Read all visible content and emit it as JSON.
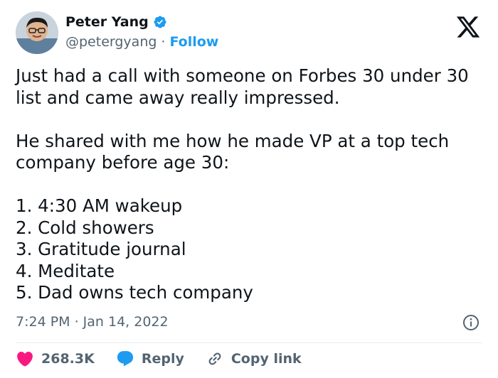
{
  "author": {
    "name": "Peter Yang",
    "handle": "@petergyang",
    "separator": "·",
    "follow_label": "Follow"
  },
  "tweet": {
    "paragraph1": "Just had a call with someone on Forbes 30 under 30 list and came away really impressed.",
    "paragraph2": "He shared with me how he made VP at a top tech company before age 30:",
    "list": [
      "1. 4:30 AM wakeup",
      "2. Cold showers",
      "3. Gratitude journal",
      "4. Meditate",
      "5. Dad owns tech company"
    ],
    "timestamp": "7:24 PM · Jan 14, 2022"
  },
  "actions": {
    "likes": "268.3K",
    "reply_label": "Reply",
    "copy_link_label": "Copy link"
  },
  "colors": {
    "accent": "#1d9bf0",
    "like": "#f91880",
    "text": "#0f1419",
    "muted": "#536471"
  },
  "icons": {
    "verified": "verified-badge-icon",
    "platform": "x-logo-icon",
    "info": "info-icon",
    "like": "heart-icon",
    "reply": "speech-bubble-icon",
    "copy": "link-icon"
  }
}
